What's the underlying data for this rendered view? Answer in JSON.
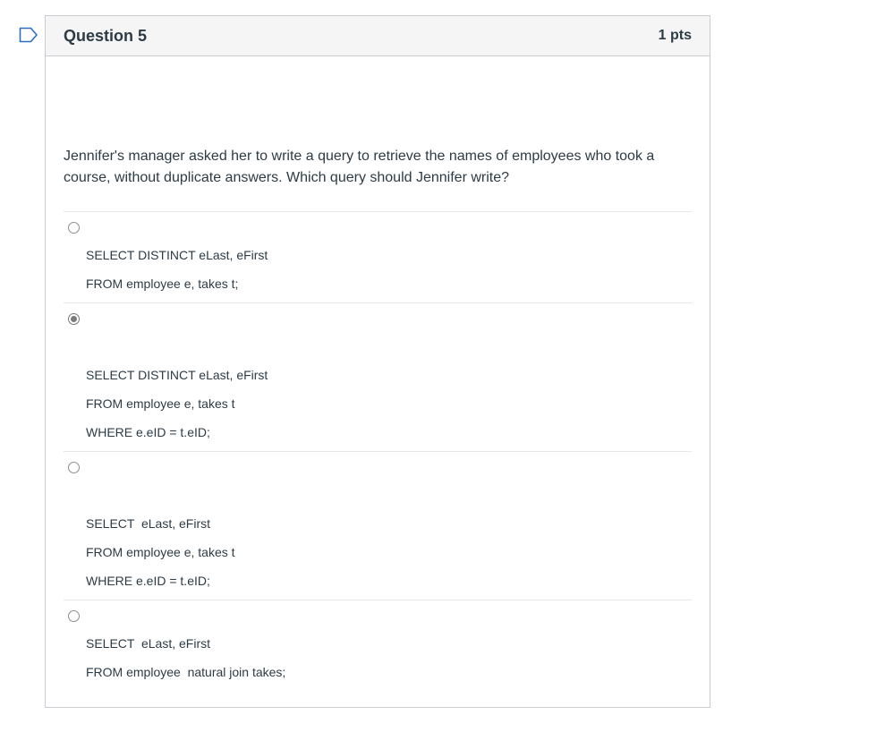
{
  "question": {
    "title": "Question 5",
    "points": "1 pts",
    "text": "Jennifer's manager asked her to write a query to retrieve the names of employees who took a course, without duplicate answers. Which query should Jennifer write?"
  },
  "answers": [
    {
      "selected": false,
      "lines": [
        "SELECT DISTINCT eLast, eFirst",
        "FROM employee e, takes t;"
      ]
    },
    {
      "selected": true,
      "lines": [
        "SELECT DISTINCT eLast, eFirst",
        "FROM employee e, takes t",
        "WHERE e.eID = t.eID;"
      ]
    },
    {
      "selected": false,
      "lines": [
        "SELECT  eLast, eFirst",
        "FROM employee e, takes t",
        "WHERE e.eID = t.eID;"
      ]
    },
    {
      "selected": false,
      "lines": [
        "SELECT  eLast, eFirst",
        "FROM employee  natural join takes;"
      ]
    }
  ],
  "icons": {
    "flag": "bookmark-flag-icon"
  },
  "colors": {
    "text": "#2d3b45",
    "header_bg": "#f5f5f5",
    "border": "#c7cdd1",
    "flag": "#2d6fbf"
  }
}
